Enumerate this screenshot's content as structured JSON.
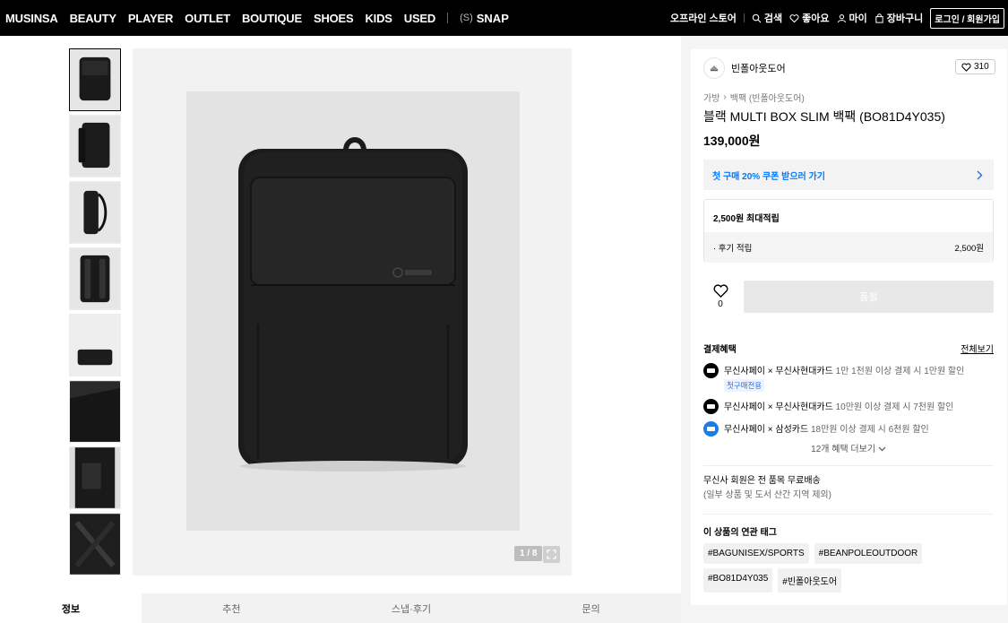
{
  "nav": {
    "items": [
      "MUSINSA",
      "BEAUTY",
      "PLAYER",
      "OUTLET",
      "BOUTIQUE",
      "SHOES",
      "KIDS",
      "USED"
    ],
    "snap_bracket": "(S)",
    "snap_label": "SNAP",
    "utils": {
      "offline_store": "오프라인 스토어",
      "search": "검색",
      "likes": "좋아요",
      "my": "마이",
      "cart": "장바구니",
      "login": "로그인 / 회원가입"
    }
  },
  "gallery": {
    "counter": "1 / 8",
    "thumb_count": 8
  },
  "tabs": [
    "정보",
    "추천",
    "스냅·후기",
    "문의"
  ],
  "product": {
    "brand": "빈폴아웃도어",
    "like_count": "310",
    "breadcrumb": [
      "가방",
      "백팩 (빈폴아웃도어)"
    ],
    "title": "블랙 MULTI BOX SLIM 백팩 (BO81D4Y035)",
    "price": "139,000원",
    "coupon": "첫 구매 20% 쿠폰 받으러 가기",
    "points": {
      "max": "2,500원 최대적립",
      "review_label": "· 후기 적립",
      "review_value": "2,500원"
    },
    "wish_count": "0",
    "buy_label": "품절"
  },
  "benefits": {
    "title": "결제혜택",
    "more": "전체보기",
    "items": [
      {
        "main": "무신사페이 × 무신사현대카드",
        "sub": " 1만 1천원 이상 결제 시 1만원 할인",
        "badge": "첫구매전용"
      },
      {
        "main": "무신사페이 × 무신사현대카드",
        "sub": " 10만원 이상 결제 시 7천원 할인"
      },
      {
        "main": "무신사페이 × 삼성카드",
        "sub": " 18만원 이상 결제 시 6천원 할인"
      }
    ],
    "expand": "12개 혜택 더보기"
  },
  "shipping": {
    "line1": "무신사 회원은 전 품목 무료배송",
    "line2": "(일부 상품 및 도서 산간 지역 제외)"
  },
  "tags": {
    "title": "이 상품의 연관 태그",
    "items": [
      "#BAGUNISEX/SPORTS",
      "#BEANPOLEOUTDOOR",
      "#BO81D4Y035",
      "#빈폴아웃도어"
    ]
  },
  "colors": {
    "accent": "#0078ff",
    "nav_bg": "#000000"
  }
}
